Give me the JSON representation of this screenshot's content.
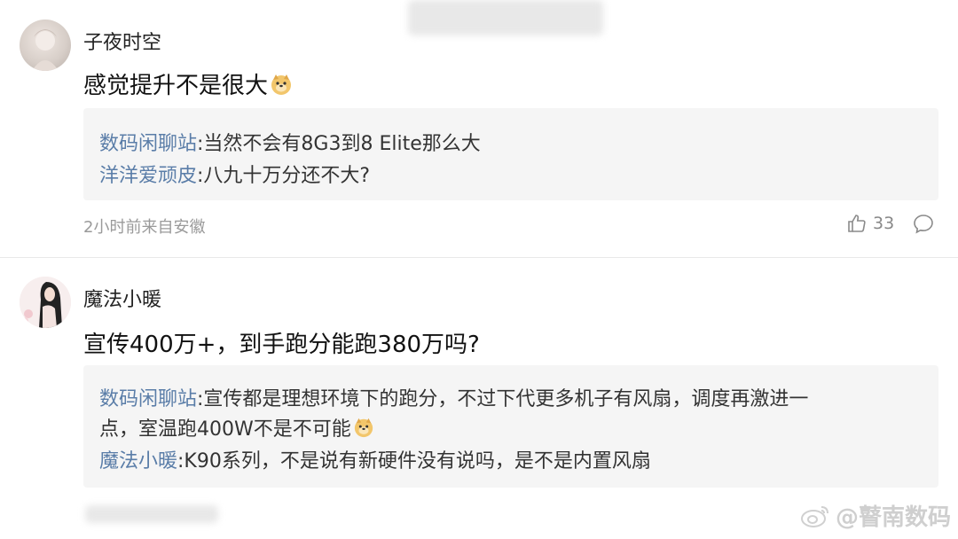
{
  "comments": [
    {
      "username": "子夜时空",
      "text": "感觉提升不是很大",
      "replies": [
        {
          "user": "数码闲聊站",
          "text": ":当然不会有8G3到8 Elite那么大"
        },
        {
          "user": "洋洋爱顽皮",
          "text": ":八九十万分还不大?"
        }
      ],
      "meta": "2小时前来自安徽",
      "likes": "33"
    },
    {
      "username": "魔法小暖",
      "text": "宣传400万+，到手跑分能跑380万吗?",
      "replies": [
        {
          "user": "数码闲聊站",
          "text": ":宣传都是理想环境下的跑分，不过下代更多机子有风扇，调度再激进一",
          "cont": "点，室温跑400W不是不可能"
        },
        {
          "user": "魔法小暖",
          "text": ":K90系列，不是说有新硬件没有说吗，是不是内置风扇"
        }
      ]
    }
  ],
  "watermark": "@瞽南数码",
  "icons": {
    "like": "thumbs-up-icon",
    "comment": "comment-bubble-icon",
    "emoji": "doge-emoji-icon",
    "weibo": "weibo-logo-icon"
  }
}
